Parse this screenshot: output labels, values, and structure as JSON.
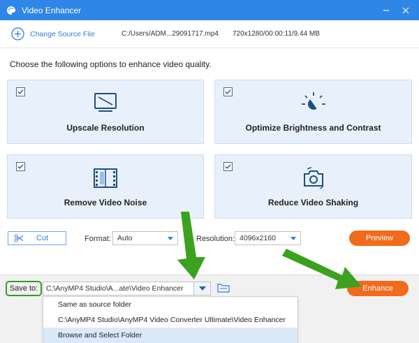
{
  "window": {
    "title": "Video Enhancer"
  },
  "file_bar": {
    "change_source_label": "Change Source File",
    "file_path": "C:/Users/ADM...29091717.mp4",
    "file_info": "720x1280/00:00:11/9.44 MB"
  },
  "instruction": "Choose the following options to enhance video quality.",
  "options": [
    {
      "label": "Upscale Resolution",
      "checked": true,
      "icon": "monitor-icon"
    },
    {
      "label": "Optimize Brightness and Contrast",
      "checked": true,
      "icon": "brightness-icon"
    },
    {
      "label": "Remove Video Noise",
      "checked": true,
      "icon": "film-icon"
    },
    {
      "label": "Reduce Video Shaking",
      "checked": true,
      "icon": "camera-stabilize-icon"
    }
  ],
  "controls": {
    "cut_label": "Cut",
    "format_label": "Format:",
    "format_value": "Auto",
    "resolution_label": "Resolution:",
    "resolution_value": "4096x2160",
    "preview_label": "Preview"
  },
  "save": {
    "label": "Save to:",
    "path": "C:\\AnyMP4 Studio\\A...ate\\Video Enhancer",
    "enhance_label": "Enhance",
    "dropdown_options": [
      "Same as source folder",
      "C:\\AnyMP4 Studio\\AnyMP4 Video Converter Ultimate\\Video Enhancer",
      "Browse and Select Folder"
    ]
  },
  "colors": {
    "title_bar": "#2e86e6",
    "accent": "#2e7fd9",
    "orange_button": "#f26a1b",
    "card_bg": "#e8f1fb",
    "highlight_green": "#3a9a1d"
  }
}
